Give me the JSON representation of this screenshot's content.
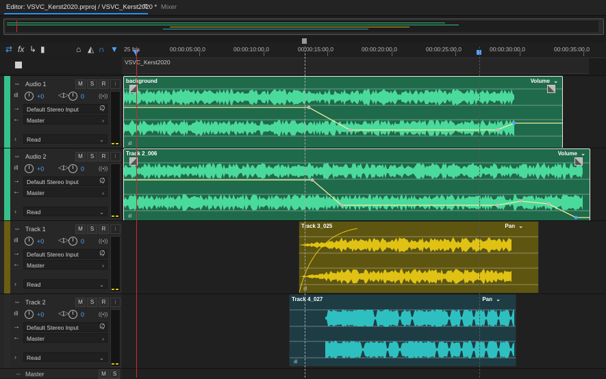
{
  "tabs": {
    "editor_label": "Editor: VSVC_Kerst2020.prproj / VSVC_Kerst2020 *",
    "menu_glyph": "≡",
    "mixer_label": "Mixer"
  },
  "ruler": {
    "start_label": "25 fps",
    "ticks": [
      "00:00:05:00,0",
      "00:00:10:00,0",
      "00:00:15:00,0",
      "00:00:20:00,0",
      "00:00:25:00,0",
      "00:00:30:00,0",
      "00:00:35:00,0"
    ]
  },
  "sequence_name": "VSVC_Kerst2020",
  "tracks": [
    {
      "name": "Audio 1",
      "volume": "+0",
      "pan": "0",
      "input": "Default Stereo Input",
      "output": "Master",
      "mode": "Read",
      "color": "#36c08a",
      "clip": {
        "title": "background",
        "param": "Volume",
        "color": "#1f6a4a",
        "wave": "#4de0a0"
      }
    },
    {
      "name": "Audio 2",
      "volume": "+0",
      "pan": "0",
      "input": "Default Stereo Input",
      "output": "Master",
      "mode": "Read",
      "color": "#36c08a",
      "clip": {
        "title": "Track 2_006",
        "param": "Volume",
        "color": "#1f6a4a",
        "wave": "#4de0a0"
      }
    },
    {
      "name": "Track 1",
      "volume": "+0",
      "pan": "0",
      "input": "Default Stereo Input",
      "output": "Master",
      "mode": "Read",
      "color": "#6b5e12",
      "clip": {
        "title": "Track 3_025",
        "param": "Pan",
        "color": "#5e5510",
        "wave": "#e6c814"
      }
    },
    {
      "name": "Track 2",
      "volume": "+0",
      "pan": "0",
      "input": "Default Stereo Input",
      "output": "Master",
      "mode": "Read",
      "color": "#2a2a2a",
      "clip": {
        "title": "Track 4_027",
        "param": "Pan",
        "color": "#1d3c44",
        "wave": "#2fc7c7"
      }
    }
  ],
  "master": {
    "name": "Master"
  },
  "buttons": {
    "mute": "M",
    "solo": "S",
    "record": "R"
  },
  "icons": [
    "toggle-icon",
    "fx-icon",
    "send-icon",
    "meter-icon",
    "pencil-icon",
    "fade-icon",
    "headphones-icon",
    "marker-icon"
  ]
}
